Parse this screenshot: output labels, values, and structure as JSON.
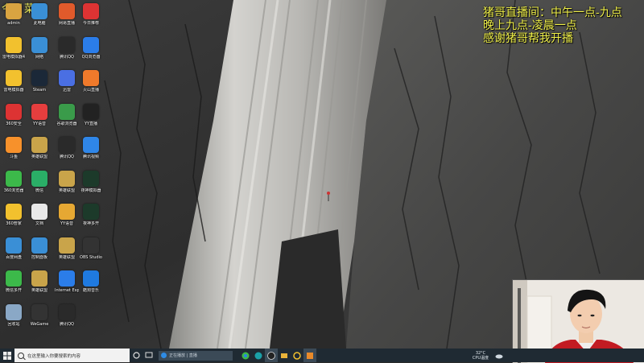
{
  "overlay": {
    "corner_title": "今日菜单",
    "stream_lines": [
      "猪哥直播间：中午一点-九点",
      "晚上九点-凌晨一点",
      "感谢猪哥帮我开播"
    ]
  },
  "desktop_icons": [
    {
      "label": "admin",
      "icon": "folder-icon",
      "color": "#d9a441"
    },
    {
      "label": "此电脑",
      "icon": "computer-icon",
      "color": "#3a8fd6"
    },
    {
      "label": "网易直播",
      "icon": "live-icon",
      "color": "#e05a2b"
    },
    {
      "label": "今日推荐",
      "icon": "star-icon",
      "color": "#d33"
    },
    {
      "label": "雷电模拟器4",
      "icon": "emulator-icon",
      "color": "#f2c12e"
    },
    {
      "label": "网络",
      "icon": "network-icon",
      "color": "#3a8fd6"
    },
    {
      "label": "腾讯QQ",
      "icon": "qq-icon",
      "color": "#2a2a2a"
    },
    {
      "label": "QQ浏览器",
      "icon": "browser-icon",
      "color": "#2b7de9"
    },
    {
      "label": "雷电模拟器",
      "icon": "emulator-icon",
      "color": "#f2c12e"
    },
    {
      "label": "Steam",
      "icon": "steam-icon",
      "color": "#1b2838"
    },
    {
      "label": "迅雷",
      "icon": "thunder-icon",
      "color": "#4a6fe3"
    },
    {
      "label": "火山直播",
      "icon": "fire-icon",
      "color": "#f07a2b"
    },
    {
      "label": "360安全",
      "icon": "shield-icon",
      "color": "#d33"
    },
    {
      "label": "YY语音",
      "icon": "yy-icon",
      "color": "#e63e3e"
    },
    {
      "label": "谷歌浏览器",
      "icon": "chrome-icon",
      "color": "#3a9b4a"
    },
    {
      "label": "YY直播",
      "icon": "circle-icon",
      "color": "#222"
    },
    {
      "label": "斗鱼",
      "icon": "fish-icon",
      "color": "#f7912b"
    },
    {
      "label": "英雄联盟",
      "icon": "game-icon",
      "color": "#c9a44a"
    },
    {
      "label": "腾讯QQ",
      "icon": "qq-icon",
      "color": "#2a2a2a"
    },
    {
      "label": "腾讯视频",
      "icon": "video-icon",
      "color": "#2f86e8"
    },
    {
      "label": "360浏览器",
      "icon": "browser-icon",
      "color": "#3cb94a"
    },
    {
      "label": "微信",
      "icon": "wechat-icon",
      "color": "#2aae67"
    },
    {
      "label": "英雄联盟",
      "icon": "game-icon",
      "color": "#c9a44a"
    },
    {
      "label": "夜神模拟器",
      "icon": "nox-icon",
      "color": "#1c3a2a"
    },
    {
      "label": "360管家",
      "icon": "leaf-icon",
      "color": "#f2c12e"
    },
    {
      "label": "文档",
      "icon": "file-icon",
      "color": "#e8e8e8"
    },
    {
      "label": "YY语音",
      "icon": "yy-icon",
      "color": "#e6a833"
    },
    {
      "label": "夜神多开",
      "icon": "nox-icon",
      "color": "#1c3a2a"
    },
    {
      "label": "百度网盘",
      "icon": "cloud-icon",
      "color": "#3a8fd6"
    },
    {
      "label": "控制面板",
      "icon": "panel-icon",
      "color": "#3a8fd6"
    },
    {
      "label": "英雄联盟",
      "icon": "game-icon",
      "color": "#c9a44a"
    },
    {
      "label": "OBS Studio",
      "icon": "obs-icon",
      "color": "#333"
    },
    {
      "label": "微信多开",
      "icon": "plus-icon",
      "color": "#3cb94a"
    },
    {
      "label": "英雄联盟",
      "icon": "game-icon",
      "color": "#c9a44a"
    },
    {
      "label": "Internet Explorer",
      "icon": "ie-icon",
      "color": "#2b7de9"
    },
    {
      "label": "酷狗音乐",
      "icon": "k-icon",
      "color": "#1f7ae0"
    },
    {
      "label": "回收站",
      "icon": "recycle-icon",
      "color": "#8aa8c6"
    },
    {
      "label": "WeGame",
      "icon": "wegame-icon",
      "color": "#333"
    },
    {
      "label": "腾讯QQ",
      "icon": "qq-icon",
      "color": "#2a2a2a"
    }
  ],
  "taskbar": {
    "search_placeholder": "在这里输入你要搜索的内容",
    "edge_tab": "正在播放 | 直播",
    "temp": "32°C",
    "temp_label": "CPU温度"
  }
}
